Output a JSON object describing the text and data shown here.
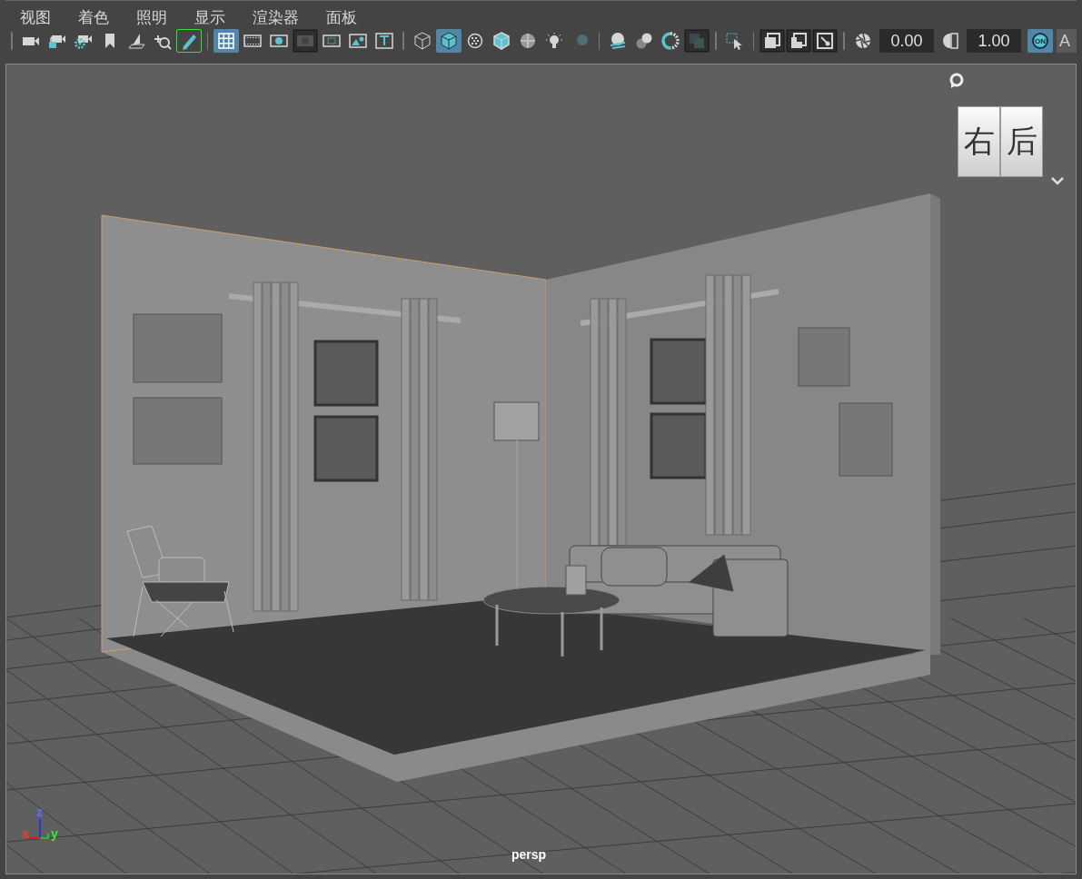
{
  "menu": [
    {
      "label": "视图"
    },
    {
      "label": "着色"
    },
    {
      "label": "照明"
    },
    {
      "label": "显示"
    },
    {
      "label": "渲染器"
    },
    {
      "label": "面板"
    }
  ],
  "toolbar": {
    "groups": [
      {
        "items": [
          {
            "kind": "button",
            "selected": false,
            "pressed": false,
            "outlined": false,
            "disabled": false
          },
          {
            "kind": "button",
            "selected": false,
            "pressed": false,
            "outlined": false,
            "disabled": false
          },
          {
            "kind": "button",
            "selected": false,
            "pressed": false,
            "outlined": false,
            "disabled": false
          },
          {
            "kind": "button",
            "selected": false,
            "pressed": false,
            "outlined": false,
            "disabled": false
          },
          {
            "kind": "button",
            "selected": false,
            "pressed": false,
            "outlined": false,
            "disabled": false
          },
          {
            "kind": "button",
            "selected": false,
            "pressed": false,
            "outlined": false,
            "disabled": false
          },
          {
            "kind": "button",
            "selected": false,
            "pressed": false,
            "outlined": true,
            "disabled": false
          }
        ]
      },
      {
        "items": [
          {
            "kind": "button",
            "selected": true,
            "pressed": false,
            "outlined": false,
            "disabled": false
          },
          {
            "kind": "button",
            "selected": false,
            "pressed": false,
            "outlined": false,
            "disabled": false
          },
          {
            "kind": "button",
            "selected": false,
            "pressed": false,
            "outlined": false,
            "disabled": false
          },
          {
            "kind": "button",
            "selected": false,
            "pressed": true,
            "outlined": false,
            "disabled": false
          },
          {
            "kind": "button",
            "selected": false,
            "pressed": false,
            "outlined": false,
            "disabled": false
          },
          {
            "kind": "button",
            "selected": false,
            "pressed": false,
            "outlined": false,
            "disabled": false
          },
          {
            "kind": "button",
            "selected": false,
            "pressed": false,
            "outlined": false,
            "disabled": false
          }
        ]
      },
      {
        "items": [
          {
            "kind": "button",
            "selected": false,
            "pressed": false,
            "outlined": false,
            "disabled": false
          },
          {
            "kind": "button",
            "selected": true,
            "pressed": false,
            "outlined": false,
            "disabled": false
          },
          {
            "kind": "button",
            "selected": false,
            "pressed": false,
            "outlined": false,
            "disabled": false
          },
          {
            "kind": "button",
            "selected": false,
            "pressed": false,
            "outlined": false,
            "disabled": false
          },
          {
            "kind": "button",
            "selected": false,
            "pressed": false,
            "outlined": false,
            "disabled": false
          },
          {
            "kind": "button",
            "selected": false,
            "pressed": false,
            "outlined": false,
            "disabled": false
          },
          {
            "kind": "button",
            "selected": false,
            "pressed": false,
            "outlined": false,
            "disabled": true
          }
        ]
      },
      {
        "items": [
          {
            "kind": "button",
            "selected": false,
            "pressed": false,
            "outlined": false,
            "disabled": false
          },
          {
            "kind": "button",
            "selected": false,
            "pressed": false,
            "outlined": false,
            "disabled": false
          },
          {
            "kind": "button",
            "selected": false,
            "pressed": false,
            "outlined": false,
            "disabled": false
          },
          {
            "kind": "button",
            "selected": false,
            "pressed": true,
            "outlined": false,
            "disabled": false
          }
        ]
      },
      {
        "items": [
          {
            "kind": "button",
            "selected": false,
            "pressed": false,
            "outlined": false,
            "disabled": false
          }
        ]
      },
      {
        "items": [
          {
            "kind": "button",
            "selected": false,
            "pressed": true,
            "outlined": false,
            "disabled": false
          },
          {
            "kind": "button",
            "selected": false,
            "pressed": true,
            "outlined": false,
            "disabled": false
          },
          {
            "kind": "button",
            "selected": false,
            "pressed": true,
            "outlined": false,
            "disabled": false
          }
        ]
      },
      {
        "items": [
          {
            "kind": "button",
            "selected": false,
            "pressed": false,
            "outlined": false,
            "disabled": false
          },
          {
            "kind": "field",
            "value": "0.00"
          },
          {
            "kind": "button",
            "selected": false,
            "pressed": false,
            "outlined": false,
            "disabled": false
          },
          {
            "kind": "field",
            "value": "1.00"
          },
          {
            "kind": "toggle",
            "label": "ON",
            "selected": true
          },
          {
            "kind": "text_button",
            "label": "A"
          }
        ]
      }
    ]
  },
  "view_cube": {
    "faces": [
      {
        "label": "右"
      },
      {
        "label": "后"
      }
    ]
  },
  "axis": {
    "labels": [
      {
        "label": "z"
      },
      {
        "label": "x"
      },
      {
        "label": "y"
      }
    ]
  },
  "camera_label": "persp"
}
